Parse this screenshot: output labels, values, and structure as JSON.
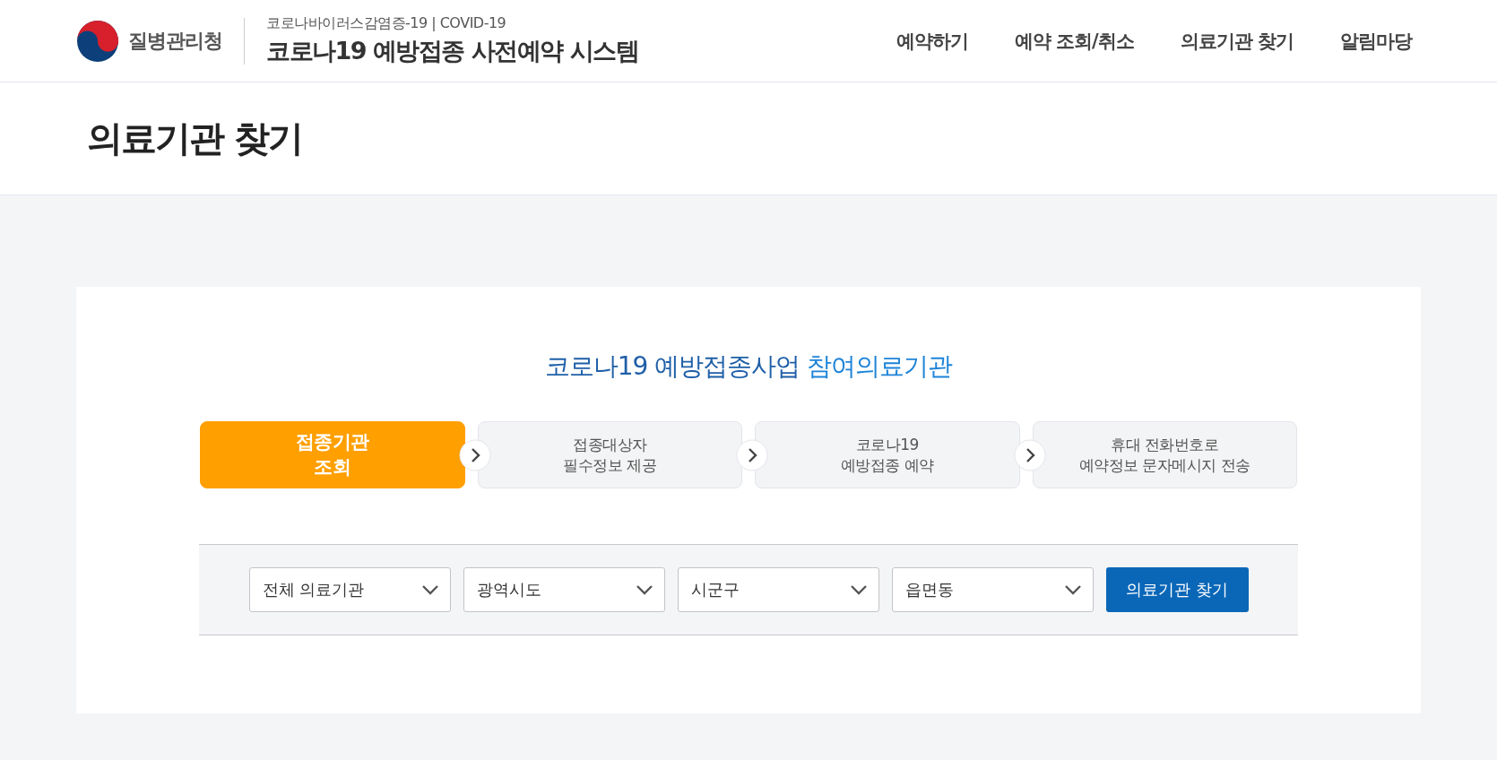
{
  "header": {
    "agency": "질병관리청",
    "subtitle": "코로나바이러스감염증-19 | COVID-19",
    "system_title": "코로나19 예방접종 사전예약 시스템"
  },
  "nav": [
    {
      "label": "예약하기"
    },
    {
      "label": "예약 조회/취소"
    },
    {
      "label": "의료기관 찾기"
    },
    {
      "label": "알림마당"
    }
  ],
  "page_title": "의료기관 찾기",
  "heading": {
    "lead": "코로나19 예방접종사업 ",
    "highlight": "참여의료기관"
  },
  "steps": [
    {
      "lines": [
        "접종기관",
        "조회"
      ],
      "selected": true
    },
    {
      "lines": [
        "접종대상자",
        "필수정보 제공"
      ],
      "selected": false
    },
    {
      "lines": [
        "코로나19",
        "예방접종 예약"
      ],
      "selected": false
    },
    {
      "lines": [
        "휴대 전화번호로",
        "예약정보 문자메시지 전송"
      ],
      "selected": false
    }
  ],
  "filters": [
    {
      "value": "전체 의료기관"
    },
    {
      "value": "광역시도"
    },
    {
      "value": "시군구"
    },
    {
      "value": "읍면동"
    }
  ],
  "search_button": "의료기관 찾기"
}
